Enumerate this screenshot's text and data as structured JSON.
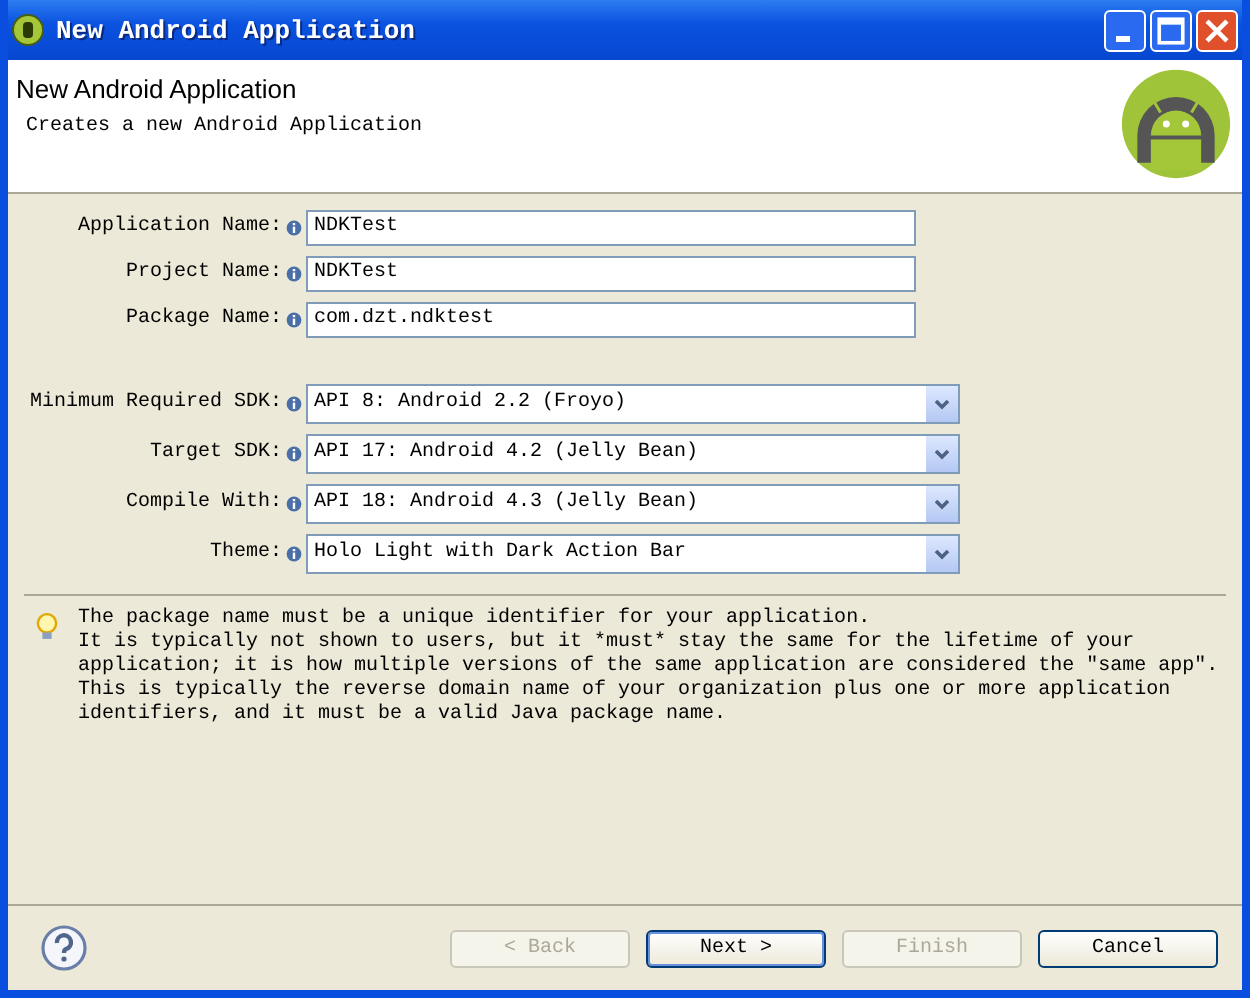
{
  "window": {
    "title": "New Android Application"
  },
  "header": {
    "title": "New Android Application",
    "subtitle": "Creates a new Android Application"
  },
  "text_fields": [
    {
      "label": "Application Name:",
      "value": "NDKTest"
    },
    {
      "label": "Project Name:",
      "value": "NDKTest"
    },
    {
      "label": "Package Name:",
      "value": "com.dzt.ndktest"
    }
  ],
  "dropdowns": [
    {
      "label": "Minimum Required SDK:",
      "value": "API 8: Android 2.2 (Froyo)"
    },
    {
      "label": "Target SDK:",
      "value": "API 17: Android 4.2 (Jelly Bean)"
    },
    {
      "label": "Compile With:",
      "value": "API 18: Android 4.3 (Jelly Bean)"
    },
    {
      "label": "Theme:",
      "value": "Holo Light with Dark Action Bar"
    }
  ],
  "hint": "The package name must be a unique identifier for your application.\nIt is typically not shown to users, but it *must* stay the same for the lifetime of your\napplication; it is how multiple versions of the same application are considered the \"same app\".\nThis is typically the reverse domain name of your organization plus one or more application\nidentifiers, and it must be a valid Java package name.",
  "buttons": [
    {
      "label": "< Back",
      "disabled": true,
      "default": false
    },
    {
      "label": "Next >",
      "disabled": false,
      "default": true
    },
    {
      "label": "Finish",
      "disabled": true,
      "default": false
    },
    {
      "label": "Cancel",
      "disabled": false,
      "default": false
    }
  ]
}
